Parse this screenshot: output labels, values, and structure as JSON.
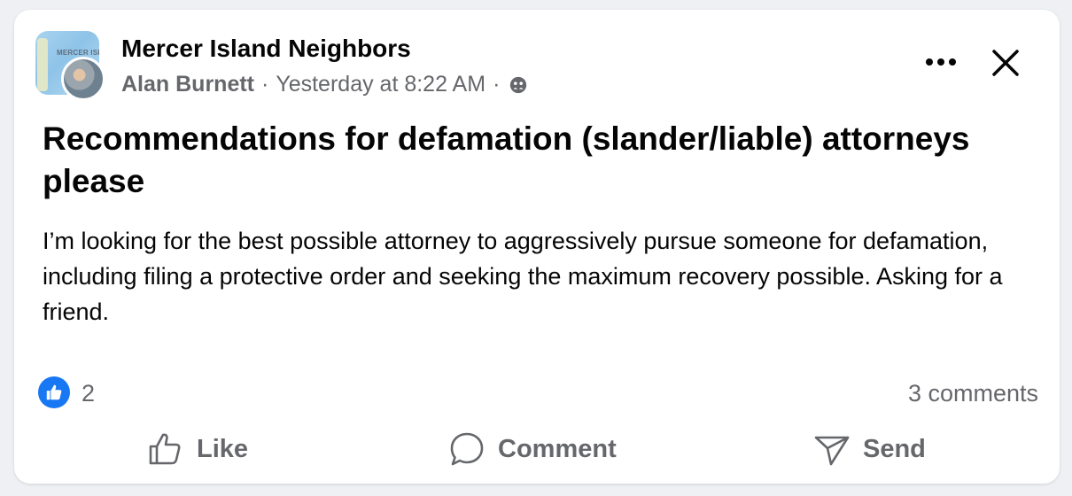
{
  "post": {
    "group_name": "Mercer Island Neighbors",
    "group_avatar_text": "MERCER ISLA",
    "author": "Alan Burnett",
    "separator": "·",
    "timestamp": "Yesterday at 8:22 AM",
    "audience_icon": "group-audience-icon",
    "title": "Recommendations for defamation (slander/liable) attorneys please",
    "body": "I’m looking for the best possible attorney to aggressively pursue someone for defamation, including filing a protective order and seeking the maximum recovery possible. Asking for a friend."
  },
  "reactions": {
    "like_count": "2",
    "comments_label": "3 comments"
  },
  "actions": {
    "like": "Like",
    "comment": "Comment",
    "send": "Send"
  },
  "colors": {
    "accent": "#1877f2",
    "secondary_text": "#65676b",
    "primary_text": "#050505"
  }
}
